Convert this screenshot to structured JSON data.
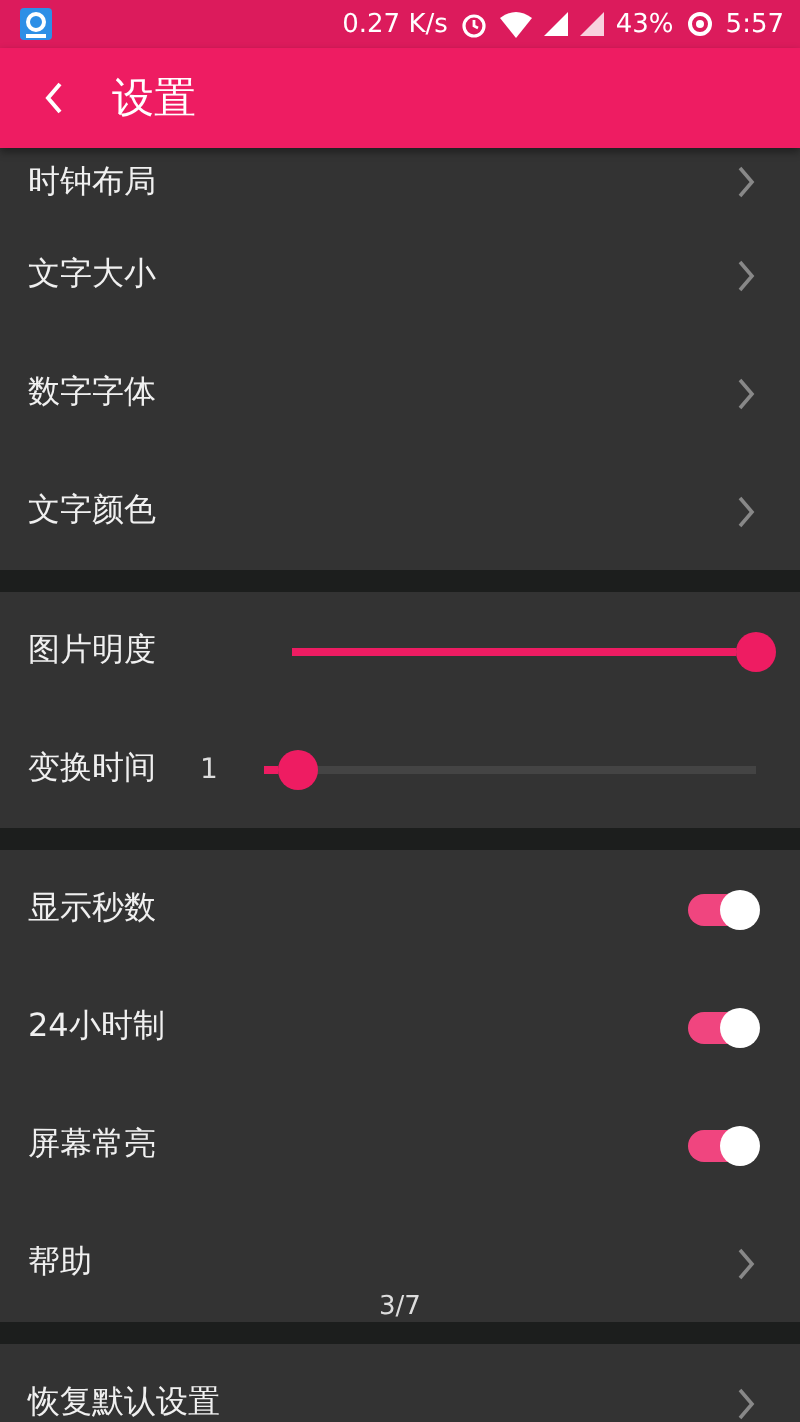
{
  "status_bar": {
    "speed": "0.27 K/s",
    "battery": "43%",
    "time": "5:57"
  },
  "app_bar": {
    "title": "设置"
  },
  "sections": [
    {
      "items": [
        {
          "kind": "link",
          "label": "时钟布局"
        },
        {
          "kind": "link",
          "label": "文字大小"
        },
        {
          "kind": "link",
          "label": "数字字体"
        },
        {
          "kind": "link",
          "label": "文字颜色"
        }
      ]
    },
    {
      "items": [
        {
          "kind": "slider",
          "label": "图片明度",
          "level": 1.0
        },
        {
          "kind": "slider",
          "label": "变换时间",
          "reading": "1",
          "level": 0.07
        }
      ]
    },
    {
      "items": [
        {
          "kind": "switch",
          "label": "显示秒数",
          "on": true
        },
        {
          "kind": "switch",
          "label": "24小时制",
          "on": true
        },
        {
          "kind": "switch",
          "label": "屏幕常亮",
          "on": true
        },
        {
          "kind": "link",
          "label": "帮助"
        }
      ]
    },
    {
      "items": [
        {
          "kind": "link",
          "label": "恢复默认设置"
        }
      ]
    }
  ],
  "page_indicator": "3/7"
}
